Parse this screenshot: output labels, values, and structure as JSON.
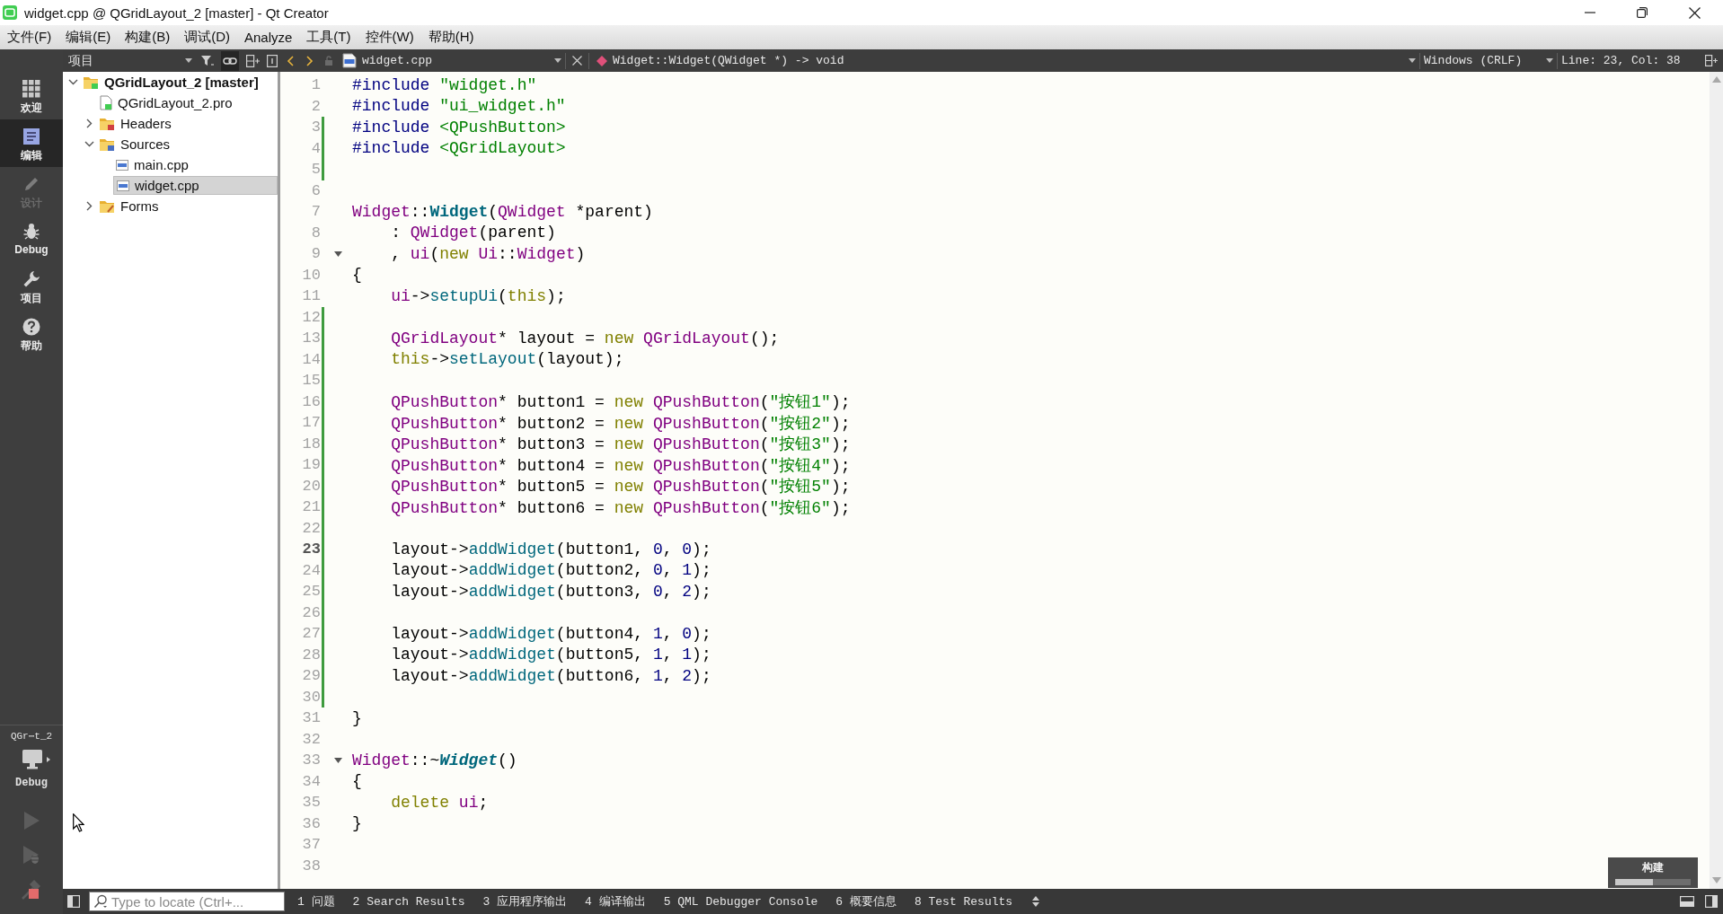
{
  "window": {
    "title": "widget.cpp @ QGridLayout_2 [master] - Qt Creator"
  },
  "menu": [
    "文件(F)",
    "编辑(E)",
    "构建(B)",
    "调试(D)",
    "Analyze",
    "工具(T)",
    "控件(W)",
    "帮助(H)"
  ],
  "mode_bar": {
    "modes": [
      {
        "kind": "welcome",
        "label": "欢迎",
        "selected": false,
        "disabled": false
      },
      {
        "kind": "edit",
        "label": "编辑",
        "selected": true,
        "disabled": false
      },
      {
        "kind": "design",
        "label": "设计",
        "selected": false,
        "disabled": true
      },
      {
        "kind": "debug",
        "label": "Debug",
        "selected": false,
        "disabled": false
      },
      {
        "kind": "projects",
        "label": "项目",
        "selected": false,
        "disabled": false
      },
      {
        "kind": "help",
        "label": "帮助",
        "selected": false,
        "disabled": false
      }
    ],
    "target": {
      "project": "QGr⋯t_2",
      "config": "Debug"
    }
  },
  "project_panel": {
    "title": "项目",
    "link_button_on": true,
    "tree": [
      {
        "kind": "project",
        "label": "QGridLayout_2 [master]",
        "expanded": true,
        "selected": false,
        "children": [
          {
            "kind": "pro-file",
            "label": "QGridLayout_2.pro",
            "selected": false
          },
          {
            "kind": "headers",
            "label": "Headers",
            "expanded": false,
            "selected": false
          },
          {
            "kind": "sources",
            "label": "Sources",
            "expanded": true,
            "selected": false,
            "children": [
              {
                "kind": "cpp-file",
                "label": "main.cpp",
                "selected": false
              },
              {
                "kind": "cpp-file",
                "label": "widget.cpp",
                "selected": true
              }
            ]
          },
          {
            "kind": "forms",
            "label": "Forms",
            "expanded": false,
            "selected": false
          }
        ]
      }
    ]
  },
  "editor_toolbar": {
    "file": "widget.cpp",
    "symbol": "Widget::Widget(QWidget *) -> void",
    "line_ending": "Windows (CRLF)",
    "cursor_position": "Line: 23, Col: 38"
  },
  "editor": {
    "lines": [
      {
        "number": "1",
        "changed": false,
        "current": false,
        "foldable": false,
        "tokens": [
          {
            "kind": "pre",
            "text": "#include "
          },
          {
            "kind": "str",
            "text": "\"widget.h\""
          }
        ]
      },
      {
        "number": "2",
        "changed": false,
        "current": false,
        "foldable": false,
        "tokens": [
          {
            "kind": "pre",
            "text": "#include "
          },
          {
            "kind": "str",
            "text": "\"ui_widget.h\""
          }
        ]
      },
      {
        "number": "3",
        "changed": true,
        "current": false,
        "foldable": false,
        "tokens": [
          {
            "kind": "pre",
            "text": "#include "
          },
          {
            "kind": "str",
            "text": "<QPushButton>"
          }
        ]
      },
      {
        "number": "4",
        "changed": true,
        "current": false,
        "foldable": false,
        "tokens": [
          {
            "kind": "pre",
            "text": "#include "
          },
          {
            "kind": "str",
            "text": "<QGridLayout>"
          }
        ]
      },
      {
        "number": "5",
        "changed": true,
        "current": false,
        "foldable": false
      },
      {
        "number": "6",
        "changed": false,
        "current": false,
        "foldable": false
      },
      {
        "number": "7",
        "changed": false,
        "current": false,
        "foldable": false,
        "tokens": [
          {
            "kind": "type",
            "text": "Widget"
          },
          {
            "kind": "plain",
            "text": "::"
          },
          {
            "kind": "func-decl",
            "text": "Widget"
          },
          {
            "kind": "plain",
            "text": "("
          },
          {
            "kind": "type",
            "text": "QWidget"
          },
          {
            "kind": "plain",
            "text": " *parent)"
          }
        ]
      },
      {
        "number": "8",
        "changed": false,
        "current": false,
        "foldable": false,
        "tokens": [
          {
            "kind": "plain",
            "text": "    : "
          },
          {
            "kind": "type",
            "text": "QWidget"
          },
          {
            "kind": "plain",
            "text": "(parent)"
          }
        ]
      },
      {
        "number": "9",
        "changed": false,
        "current": false,
        "foldable": true,
        "tokens": [
          {
            "kind": "plain",
            "text": "    , "
          },
          {
            "kind": "field",
            "text": "ui"
          },
          {
            "kind": "plain",
            "text": "("
          },
          {
            "kind": "kw",
            "text": "new "
          },
          {
            "kind": "type",
            "text": "Ui"
          },
          {
            "kind": "plain",
            "text": "::"
          },
          {
            "kind": "type",
            "text": "Widget"
          },
          {
            "kind": "plain",
            "text": ")"
          }
        ]
      },
      {
        "number": "10",
        "changed": false,
        "current": false,
        "foldable": false,
        "tokens": [
          {
            "kind": "plain",
            "text": "{"
          }
        ]
      },
      {
        "number": "11",
        "changed": false,
        "current": false,
        "foldable": false,
        "tokens": [
          {
            "kind": "field",
            "text": "    ui"
          },
          {
            "kind": "plain",
            "text": "->"
          },
          {
            "kind": "func",
            "text": "setupUi"
          },
          {
            "kind": "plain",
            "text": "("
          },
          {
            "kind": "kw",
            "text": "this"
          },
          {
            "kind": "plain",
            "text": ");"
          }
        ]
      },
      {
        "number": "12",
        "changed": true,
        "current": false,
        "foldable": false
      },
      {
        "number": "13",
        "changed": true,
        "current": false,
        "foldable": false,
        "tokens": [
          {
            "kind": "type",
            "text": "    QGridLayout"
          },
          {
            "kind": "plain",
            "text": "* layout = "
          },
          {
            "kind": "kw",
            "text": "new "
          },
          {
            "kind": "type",
            "text": "QGridLayout"
          },
          {
            "kind": "plain",
            "text": "();"
          }
        ]
      },
      {
        "number": "14",
        "changed": true,
        "current": false,
        "foldable": false,
        "tokens": [
          {
            "kind": "kw",
            "text": "    this"
          },
          {
            "kind": "plain",
            "text": "->"
          },
          {
            "kind": "func",
            "text": "setLayout"
          },
          {
            "kind": "plain",
            "text": "(layout);"
          }
        ]
      },
      {
        "number": "15",
        "changed": true,
        "current": false,
        "foldable": false
      },
      {
        "number": "16",
        "changed": true,
        "current": false,
        "foldable": false,
        "tokens": [
          {
            "kind": "type",
            "text": "    QPushButton"
          },
          {
            "kind": "plain",
            "text": "* button1 = "
          },
          {
            "kind": "kw",
            "text": "new "
          },
          {
            "kind": "type",
            "text": "QPushButton"
          },
          {
            "kind": "plain",
            "text": "("
          },
          {
            "kind": "str",
            "text": "\"按钮1\""
          },
          {
            "kind": "plain",
            "text": ");"
          }
        ]
      },
      {
        "number": "17",
        "changed": true,
        "current": false,
        "foldable": false,
        "tokens": [
          {
            "kind": "type",
            "text": "    QPushButton"
          },
          {
            "kind": "plain",
            "text": "* button2 = "
          },
          {
            "kind": "kw",
            "text": "new "
          },
          {
            "kind": "type",
            "text": "QPushButton"
          },
          {
            "kind": "plain",
            "text": "("
          },
          {
            "kind": "str",
            "text": "\"按钮2\""
          },
          {
            "kind": "plain",
            "text": ");"
          }
        ]
      },
      {
        "number": "18",
        "changed": true,
        "current": false,
        "foldable": false,
        "tokens": [
          {
            "kind": "type",
            "text": "    QPushButton"
          },
          {
            "kind": "plain",
            "text": "* button3 = "
          },
          {
            "kind": "kw",
            "text": "new "
          },
          {
            "kind": "type",
            "text": "QPushButton"
          },
          {
            "kind": "plain",
            "text": "("
          },
          {
            "kind": "str",
            "text": "\"按钮3\""
          },
          {
            "kind": "plain",
            "text": ");"
          }
        ]
      },
      {
        "number": "19",
        "changed": true,
        "current": false,
        "foldable": false,
        "tokens": [
          {
            "kind": "type",
            "text": "    QPushButton"
          },
          {
            "kind": "plain",
            "text": "* button4 = "
          },
          {
            "kind": "kw",
            "text": "new "
          },
          {
            "kind": "type",
            "text": "QPushButton"
          },
          {
            "kind": "plain",
            "text": "("
          },
          {
            "kind": "str",
            "text": "\"按钮4\""
          },
          {
            "kind": "plain",
            "text": ");"
          }
        ]
      },
      {
        "number": "20",
        "changed": true,
        "current": false,
        "foldable": false,
        "tokens": [
          {
            "kind": "type",
            "text": "    QPushButton"
          },
          {
            "kind": "plain",
            "text": "* button5 = "
          },
          {
            "kind": "kw",
            "text": "new "
          },
          {
            "kind": "type",
            "text": "QPushButton"
          },
          {
            "kind": "plain",
            "text": "("
          },
          {
            "kind": "str",
            "text": "\"按钮5\""
          },
          {
            "kind": "plain",
            "text": ");"
          }
        ]
      },
      {
        "number": "21",
        "changed": true,
        "current": false,
        "foldable": false,
        "tokens": [
          {
            "kind": "type",
            "text": "    QPushButton"
          },
          {
            "kind": "plain",
            "text": "* button6 = "
          },
          {
            "kind": "kw",
            "text": "new "
          },
          {
            "kind": "type",
            "text": "QPushButton"
          },
          {
            "kind": "plain",
            "text": "("
          },
          {
            "kind": "str",
            "text": "\"按钮6\""
          },
          {
            "kind": "plain",
            "text": ");"
          }
        ]
      },
      {
        "number": "22",
        "changed": true,
        "current": false,
        "foldable": false
      },
      {
        "number": "23",
        "changed": true,
        "current": true,
        "foldable": false,
        "tokens": [
          {
            "kind": "plain",
            "text": "    layout->"
          },
          {
            "kind": "func",
            "text": "addWidget"
          },
          {
            "kind": "plain",
            "text": "(button1, "
          },
          {
            "kind": "num",
            "text": "0"
          },
          {
            "kind": "plain",
            "text": ", "
          },
          {
            "kind": "num",
            "text": "0"
          },
          {
            "kind": "plain",
            "text": ");"
          }
        ]
      },
      {
        "number": "24",
        "changed": true,
        "current": false,
        "foldable": false,
        "tokens": [
          {
            "kind": "plain",
            "text": "    layout->"
          },
          {
            "kind": "func",
            "text": "addWidget"
          },
          {
            "kind": "plain",
            "text": "(button2, "
          },
          {
            "kind": "num",
            "text": "0"
          },
          {
            "kind": "plain",
            "text": ", "
          },
          {
            "kind": "num",
            "text": "1"
          },
          {
            "kind": "plain",
            "text": ");"
          }
        ]
      },
      {
        "number": "25",
        "changed": true,
        "current": false,
        "foldable": false,
        "tokens": [
          {
            "kind": "plain",
            "text": "    layout->"
          },
          {
            "kind": "func",
            "text": "addWidget"
          },
          {
            "kind": "plain",
            "text": "(button3, "
          },
          {
            "kind": "num",
            "text": "0"
          },
          {
            "kind": "plain",
            "text": ", "
          },
          {
            "kind": "num",
            "text": "2"
          },
          {
            "kind": "plain",
            "text": ");"
          }
        ]
      },
      {
        "number": "26",
        "changed": true,
        "current": false,
        "foldable": false
      },
      {
        "number": "27",
        "changed": true,
        "current": false,
        "foldable": false,
        "tokens": [
          {
            "kind": "plain",
            "text": "    layout->"
          },
          {
            "kind": "func",
            "text": "addWidget"
          },
          {
            "kind": "plain",
            "text": "(button4, "
          },
          {
            "kind": "num",
            "text": "1"
          },
          {
            "kind": "plain",
            "text": ", "
          },
          {
            "kind": "num",
            "text": "0"
          },
          {
            "kind": "plain",
            "text": ");"
          }
        ]
      },
      {
        "number": "28",
        "changed": true,
        "current": false,
        "foldable": false,
        "tokens": [
          {
            "kind": "plain",
            "text": "    layout->"
          },
          {
            "kind": "func",
            "text": "addWidget"
          },
          {
            "kind": "plain",
            "text": "(button5, "
          },
          {
            "kind": "num",
            "text": "1"
          },
          {
            "kind": "plain",
            "text": ", "
          },
          {
            "kind": "num",
            "text": "1"
          },
          {
            "kind": "plain",
            "text": ");"
          }
        ]
      },
      {
        "number": "29",
        "changed": true,
        "current": false,
        "foldable": false,
        "tokens": [
          {
            "kind": "plain",
            "text": "    layout->"
          },
          {
            "kind": "func",
            "text": "addWidget"
          },
          {
            "kind": "plain",
            "text": "(button6, "
          },
          {
            "kind": "num",
            "text": "1"
          },
          {
            "kind": "plain",
            "text": ", "
          },
          {
            "kind": "num",
            "text": "2"
          },
          {
            "kind": "plain",
            "text": ");"
          }
        ]
      },
      {
        "number": "30",
        "changed": true,
        "current": false,
        "foldable": false
      },
      {
        "number": "31",
        "changed": false,
        "current": false,
        "foldable": false,
        "tokens": [
          {
            "kind": "plain",
            "text": "}"
          }
        ]
      },
      {
        "number": "32",
        "changed": false,
        "current": false,
        "foldable": false
      },
      {
        "number": "33",
        "changed": false,
        "current": false,
        "foldable": true,
        "tokens": [
          {
            "kind": "type",
            "text": "Widget"
          },
          {
            "kind": "plain",
            "text": "::~"
          },
          {
            "kind": "dtor-decl",
            "text": "Widget"
          },
          {
            "kind": "plain",
            "text": "()"
          }
        ]
      },
      {
        "number": "34",
        "changed": false,
        "current": false,
        "foldable": false,
        "tokens": [
          {
            "kind": "plain",
            "text": "{"
          }
        ]
      },
      {
        "number": "35",
        "changed": false,
        "current": false,
        "foldable": false,
        "tokens": [
          {
            "kind": "kw",
            "text": "    delete "
          },
          {
            "kind": "field",
            "text": "ui"
          },
          {
            "kind": "plain",
            "text": ";"
          }
        ]
      },
      {
        "number": "36",
        "changed": false,
        "current": false,
        "foldable": false,
        "tokens": [
          {
            "kind": "plain",
            "text": "}"
          }
        ]
      },
      {
        "number": "37",
        "changed": false,
        "current": false,
        "foldable": false
      },
      {
        "number": "38",
        "changed": false,
        "current": false,
        "foldable": false
      }
    ]
  },
  "build_progress": {
    "label": "构建",
    "level": 0.5
  },
  "status_bar": {
    "locator": {
      "placeholder": "Type to locate (Ctrl+..."
    },
    "output_panes": [
      "1 问题",
      "2 Search Results",
      "3 应用程序输出",
      "4 编译输出",
      "5 QML Debugger Console",
      "6 概要信息",
      "8 Test Results"
    ]
  }
}
